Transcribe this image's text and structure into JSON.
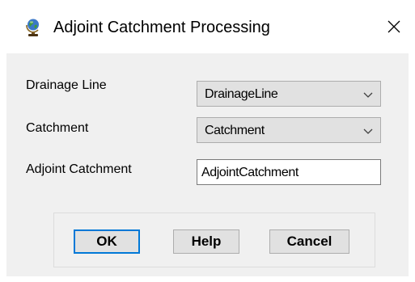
{
  "window": {
    "title": "Adjoint Catchment Processing",
    "icon": "globe-icon",
    "close_icon": "close-icon",
    "accent_color": "#0078d7"
  },
  "form": {
    "drainage_line": {
      "label": "Drainage Line",
      "selected": "DrainageLine"
    },
    "catchment": {
      "label": "Catchment",
      "selected": "Catchment"
    },
    "adjoint_catchment": {
      "label": "Adjoint Catchment",
      "value": "AdjointCatchment"
    }
  },
  "buttons": {
    "ok": "OK",
    "help": "Help",
    "cancel": "Cancel"
  }
}
